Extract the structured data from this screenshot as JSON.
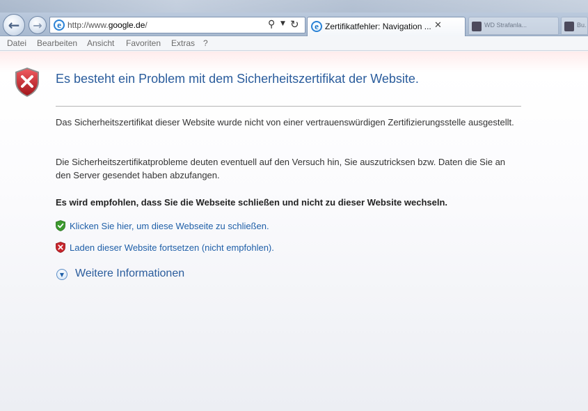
{
  "browser": {
    "url_prefix": "http://www.",
    "url_domain": "google.de",
    "url_suffix": "/",
    "tab_title": "Zertifikatfehler: Navigation ...",
    "ghost_tabs": [
      "WD Strafanla...",
      "Bu..."
    ],
    "icons": {
      "back": "back-arrow-icon",
      "forward": "forward-arrow-icon",
      "search": "search-icon",
      "refresh": "refresh-icon",
      "close": "close-icon",
      "ie": "ie-logo-icon"
    }
  },
  "menu": {
    "items": [
      "Datei",
      "Bearbeiten",
      "Ansicht",
      "Favoriten",
      "Extras",
      "?"
    ]
  },
  "page": {
    "heading": "Es besteht ein Problem mit dem Sicherheitszertifikat der Website.",
    "paragraph1": "Das Sicherheitszertifikat dieser Website wurde nicht von einer vertrauenswürdigen Zertifizierungsstelle ausgestellt.",
    "paragraph2": "Die Sicherheitszertifikatprobleme deuten eventuell auf den Versuch hin, Sie auszutricksen bzw. Daten die Sie an den Server gesendet haben abzufangen.",
    "recommendation": "Es wird empfohlen, dass Sie die Webseite schließen und nicht zu dieser Website wechseln.",
    "close_link": "Klicken Sie hier, um diese Webseite zu schließen.",
    "continue_link": "Laden dieser Website fortsetzen (nicht empfohlen).",
    "more_info": "Weitere Informationen"
  },
  "colors": {
    "heading": "#2a5c9c",
    "link": "#1f5fa8",
    "shield_red": "#c8242b",
    "shield_green": "#3c9a2e"
  }
}
